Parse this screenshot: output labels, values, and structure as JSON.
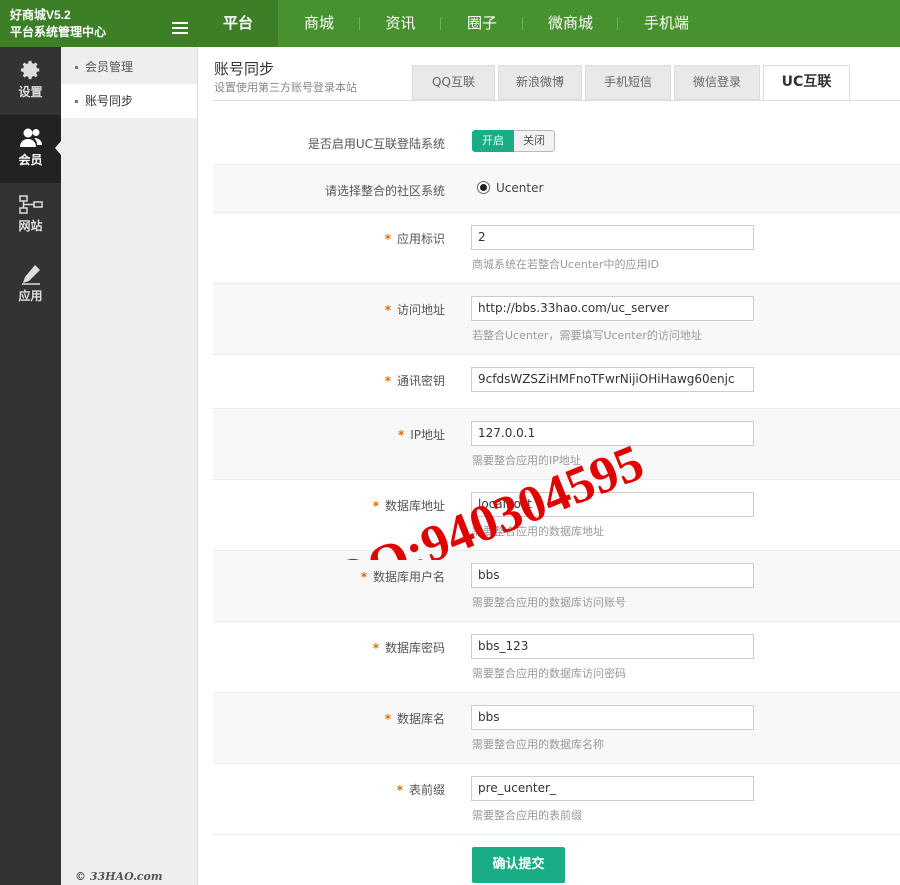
{
  "brand": {
    "title": "好商城V5.2",
    "subtitle": "平台系统管理中心"
  },
  "topnav": [
    "平台",
    "商城",
    "资讯",
    "圈子",
    "微商城",
    "手机端"
  ],
  "iconbar": [
    "设置",
    "会员",
    "网站",
    "应用"
  ],
  "subnav": [
    "会员管理",
    "账号同步"
  ],
  "footer": "© 33HAO.com",
  "page": {
    "title": "账号同步",
    "desc": "设置使用第三方账号登录本站"
  },
  "tabs": [
    "QQ互联",
    "新浪微博",
    "手机短信",
    "微信登录",
    "UC互联"
  ],
  "form": {
    "enable": {
      "label": "是否启用UC互联登陆系统",
      "on": "开启",
      "off": "关闭"
    },
    "community": {
      "label": "请选择整合的社区系统",
      "option": "Ucenter"
    },
    "fields": [
      {
        "label": "应用标识",
        "value": "2",
        "hint": "商城系统在若整合Ucenter中的应用ID"
      },
      {
        "label": "访问地址",
        "value": "http://bbs.33hao.com/uc_server",
        "hint": "若整合Ucenter，需要填写Ucenter的访问地址"
      },
      {
        "label": "通讯密钥",
        "value": "9cfdsWZSZiHMFnoTFwrNijiOHiHawg60enjc",
        "hint": ""
      },
      {
        "label": "IP地址",
        "value": "127.0.0.1",
        "hint": "需要整合应用的IP地址"
      },
      {
        "label": "数据库地址",
        "value": "localhost",
        "hint": "需要整合应用的数据库地址"
      },
      {
        "label": "数据库用户名",
        "value": "bbs",
        "hint": "需要整合应用的数据库访问账号"
      },
      {
        "label": "数据库密码",
        "value": "bbs_123",
        "hint": "需要整合应用的数据库访问密码"
      },
      {
        "label": "数据库名",
        "value": "bbs",
        "hint": "需要整合应用的数据库名称"
      },
      {
        "label": "表前缀",
        "value": "pre_ucenter_",
        "hint": "需要整合应用的表前缀"
      }
    ],
    "required_mark": "*",
    "submit": "确认提交"
  },
  "watermark": "QQ:940304595",
  "colors": {
    "header": "#47912f",
    "accent": "#1aab87",
    "watermark": "#e00000"
  }
}
